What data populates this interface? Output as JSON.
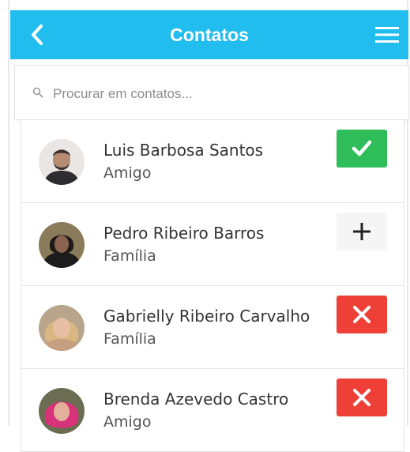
{
  "header": {
    "title": "Contatos",
    "back_icon": "chevron-left-icon",
    "menu_icon": "hamburger-menu-icon",
    "bg_color": "#21bdee"
  },
  "search": {
    "placeholder": "Procurar em contatos...",
    "value": "",
    "icon": "search-icon"
  },
  "contacts": [
    {
      "name": "Luis Barbosa Santos",
      "relation": "Amigo",
      "action": "accepted",
      "action_icon": "check-icon",
      "action_color": "#2ebd59"
    },
    {
      "name": "Pedro Ribeiro Barros",
      "relation": "Família",
      "action": "add",
      "action_icon": "plus-icon",
      "action_color": "#f5f5f5"
    },
    {
      "name": "Gabrielly Ribeiro Carvalho",
      "relation": "Família",
      "action": "remove",
      "action_icon": "close-icon",
      "action_color": "#ee4037"
    },
    {
      "name": "Brenda Azevedo Castro",
      "relation": "Amigo",
      "action": "remove",
      "action_icon": "close-icon",
      "action_color": "#ee4037"
    }
  ]
}
